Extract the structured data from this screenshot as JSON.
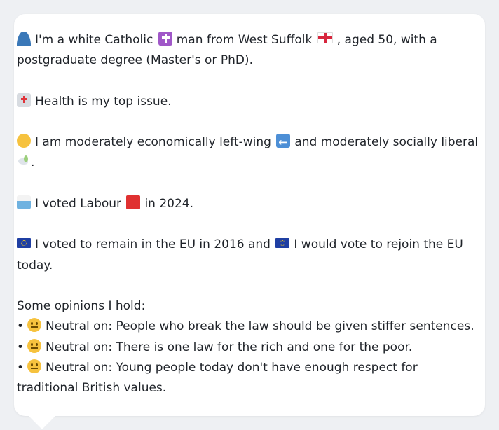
{
  "profile": {
    "intro_a": "I'm a white Catholic",
    "intro_b": "man from West Suffolk",
    "intro_c": ", aged 50, with a",
    "intro_d": "postgraduate degree (Master's or PhD).",
    "issue": "Health is my top issue.",
    "politics_a": "I am moderately economically left-wing",
    "politics_b": "and moderately socially liberal",
    "politics_c": ".",
    "vote_a": "I voted Labour",
    "vote_b": "in 2024.",
    "eu_a": "I voted to remain in the EU in 2016 and",
    "eu_b": "I would vote to rejoin the EU",
    "eu_c": "today."
  },
  "opinions": {
    "heading": "Some opinions I hold:",
    "bullet": "•",
    "items": [
      {
        "text_a": "Neutral on: People who break the law should be given stiffer sentences.",
        "text_b": ""
      },
      {
        "text_a": "Neutral on: There is one law for the rich and one for the poor.",
        "text_b": ""
      },
      {
        "text_a": "Neutral on: Young people today don't have enough respect for",
        "text_b": "traditional British values."
      }
    ]
  },
  "icons": {
    "person": "bust-in-silhouette-icon",
    "cross": "latin-cross-icon",
    "flag": "england-flag-icon",
    "hospital": "hospital-icon",
    "thinking": "thinking-face-icon",
    "left_arrow": "left-arrow-icon",
    "dove": "dove-icon",
    "ballot": "ballot-box-icon",
    "labour": "red-square-icon",
    "eu": "eu-flag-icon",
    "neutral": "neutral-face-icon"
  },
  "colors": {
    "page_bg": "#eef0f3",
    "card_bg": "#ffffff",
    "text": "#1f2329"
  }
}
